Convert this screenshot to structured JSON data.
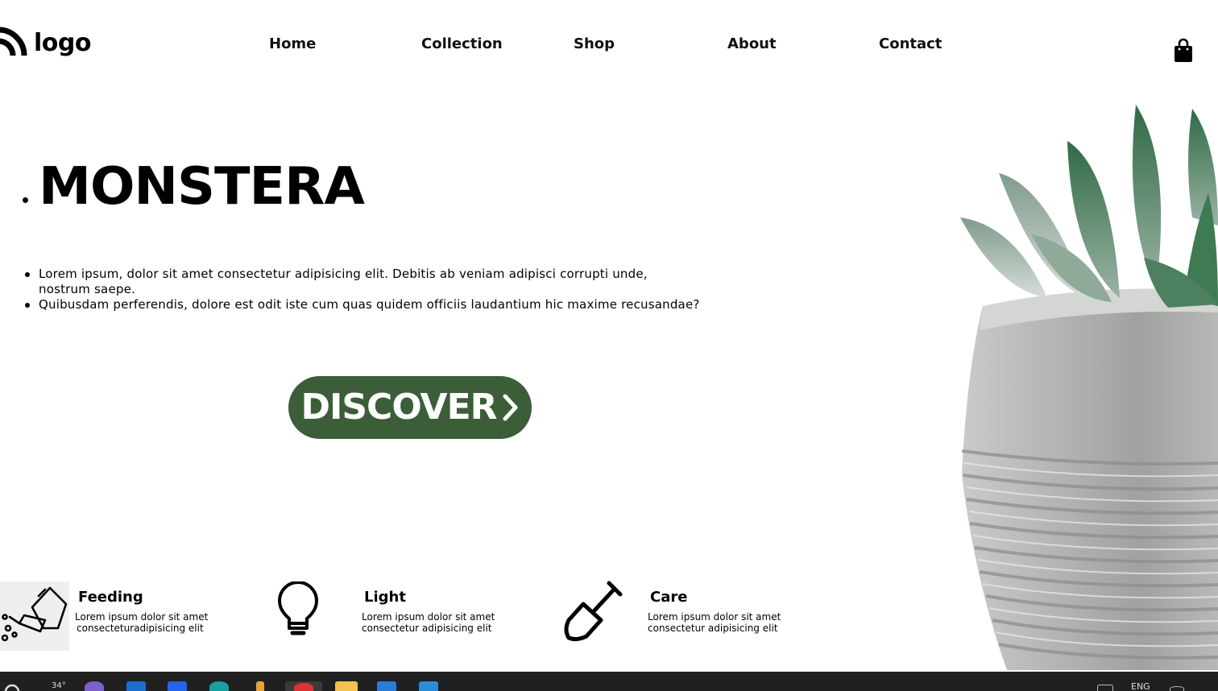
{
  "header": {
    "logo_text": "logo",
    "nav": [
      "Home",
      "Collection",
      "Shop",
      "About",
      "Contact"
    ]
  },
  "hero": {
    "title": "MONSTERA",
    "bullets": [
      "Lorem ipsum, dolor sit amet consectetur adipisicing elit. Debitis ab veniam adipisci corrupti unde, nostrum saepe.",
      "Quibusdam perferendis, dolore est odit iste cum quas quidem officiis laudantium hic maxime recusandae?"
    ],
    "button_label": "DISCOVER"
  },
  "features": [
    {
      "title": "Feeding",
      "line1": "Lorem ipsum dolor sit amet",
      "line2": "consecteturadipisicing elit",
      "icon": "watering-can-icon"
    },
    {
      "title": "Light",
      "line1": "Lorem ipsum dolor sit amet",
      "line2": "consectetur adipisicing elit",
      "icon": "light-bulb-icon"
    },
    {
      "title": "Care",
      "line1": "Lorem ipsum dolor sit amet",
      "line2": "consectetur adipisicing elit",
      "icon": "shovel-icon"
    }
  ],
  "taskbar": {
    "temperature": "34°",
    "language": "ENG"
  },
  "colors": {
    "accent": "#3b5e38",
    "taskbar": "#202020"
  }
}
